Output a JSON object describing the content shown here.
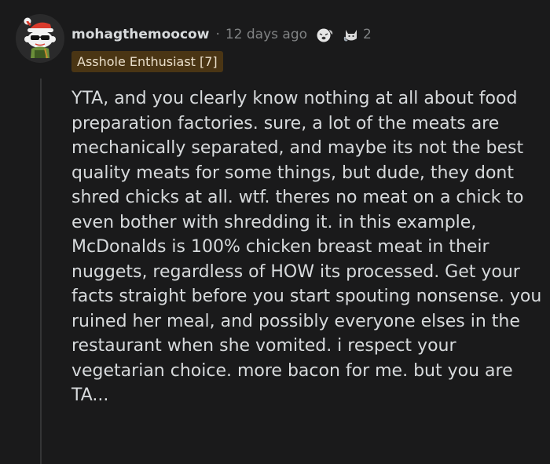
{
  "comment": {
    "author": "mohagthemoocow",
    "separator": "·",
    "age": "12 days ago",
    "award_count": "2",
    "flair": "Asshole Enthusiast [7]",
    "body": "YTA, and you clearly know nothing at all about food preparation factories. sure, a lot of the meats are mechanically separated, and maybe its not the best quality meats for some things, but dude, they dont shred chicks at all. wtf. theres no meat on a chick to even bother with shredding it. in this example, McDonalds is 100% chicken breast meat in their nuggets, regardless of HOW its processed. Get your facts straight before you start spouting nonsense. you ruined her meal, and possibly everyone elses in the restaurant when she vomited. i respect your vegetarian choice. more bacon for me. but you are TA..."
  },
  "icons": {
    "avatar": "snoo-avatar-santa-hat-sunglasses",
    "award_1": "sneezing-face-award-icon",
    "award_2": "cat-award-icon"
  },
  "colors": {
    "background": "#1a1a1b",
    "text": "#d7dadc",
    "muted": "#818384",
    "flair_background": "#4a3514",
    "flair_text": "#eadfcb",
    "thread_line": "#343536"
  }
}
